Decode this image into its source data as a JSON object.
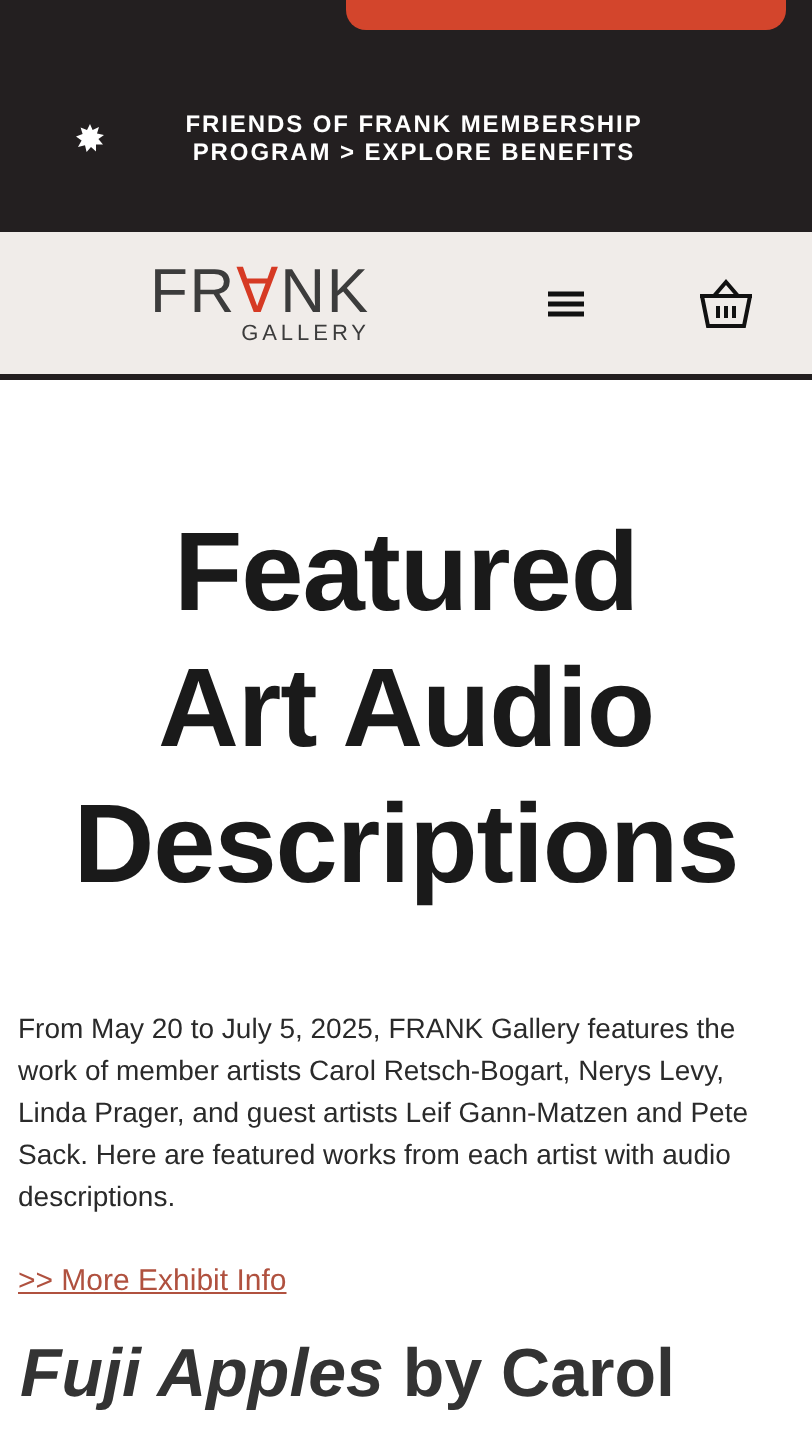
{
  "announcement": {
    "text": "FRIENDS OF FRANK MEMBERSHIP PROGRAM > EXPLORE BENEFITS"
  },
  "header": {
    "logo": {
      "parts": [
        {
          "text": "FR",
          "accent": false
        },
        {
          "text": "∀",
          "accent": true
        },
        {
          "text": "NK",
          "accent": false
        }
      ],
      "subtitle": "GALLERY"
    }
  },
  "heading": "Featured\nArt Audio\nDescriptions",
  "intro": "From May 20 to July 5, 2025, FRANK Gallery features the work of member artists Carol Retsch-Bogart, Nerys Levy, Linda Prager, and guest artists Leif Gann-Matzen and Pete Sack. Here are featured works from each artist with audio descriptions.",
  "link": ">> More Exhibit Info",
  "artwork_title": "*Fuji Apples* by Carol"
}
